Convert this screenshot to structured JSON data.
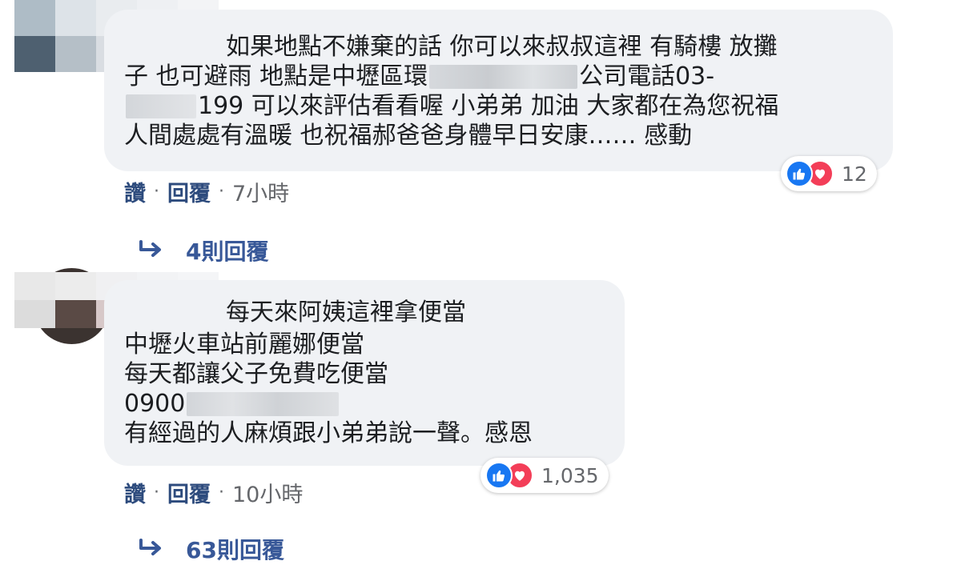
{
  "comments": [
    {
      "lines": [
        [
          "如果地點不嫌棄的話 你可以來叔叔這裡 有騎樓 放攤"
        ],
        [
          "子 也可避雨 地點是中壢區環",
          "",
          "公司電話03-"
        ],
        [
          "",
          "199 可以來評估看看喔 小弟弟 加油 大家都在為您祝福"
        ],
        [
          "人間處處有溫暖 也祝福郝爸爸身體早日安康…… 感動"
        ]
      ],
      "reactions": {
        "count": "12",
        "icons": [
          "like-icon",
          "love-icon"
        ]
      },
      "actions": {
        "like": "讚",
        "reply": "回覆",
        "time": "7小時"
      },
      "replies_label": "4則回覆"
    },
    {
      "lines": [
        [
          "每天來阿姨這裡拿便當"
        ],
        [
          "中壢火車站前麗娜便當"
        ],
        [
          "每天都讓父子免費吃便當"
        ],
        [
          "0900",
          ""
        ],
        [
          "有經過的人麻煩跟小弟弟說一聲。感恩"
        ]
      ],
      "reactions": {
        "count": "1,035",
        "icons": [
          "like-icon",
          "love-icon"
        ]
      },
      "actions": {
        "like": "讚",
        "reply": "回覆",
        "time": "10小時"
      },
      "replies_label": "63則回覆"
    }
  ],
  "colors": {
    "bubble": "#f0f2f5",
    "link": "#385898",
    "action": "#2d4b7d",
    "meta": "#65676b",
    "like": "#1877f2",
    "love": "#f33e58"
  }
}
